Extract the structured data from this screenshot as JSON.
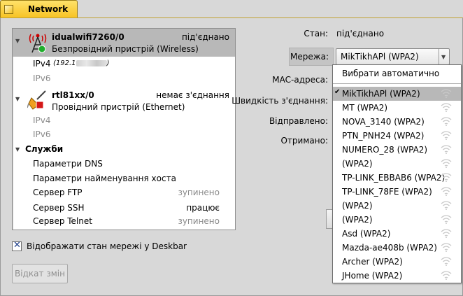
{
  "window": {
    "title": "Network"
  },
  "devices": [
    {
      "name": "idualwifi7260/0",
      "status": "під'єднано",
      "type": "Безпровідний пристрій (Wireless)",
      "ipv4_label": "IPv4",
      "ipv4_value": "(192.1",
      "ipv6_label": "IPv6",
      "icon": "wifi-antenna-icon"
    },
    {
      "name": "rtl81xx/0",
      "status": "немає з'єднання",
      "type": "Провідний пристрій (Ethernet)",
      "ipv4_label": "IPv4",
      "ipv6_label": "IPv6",
      "icon": "ethernet-plug-icon"
    }
  ],
  "services": {
    "header": "Служби",
    "items": [
      {
        "label": "Параметри DNS",
        "status": ""
      },
      {
        "label": "Параметри найменування хоста",
        "status": ""
      },
      {
        "label": "Сервер FTP",
        "status": "зупинено"
      },
      {
        "label": "Сервер SSH",
        "status": "працює"
      },
      {
        "label": "Сервер Telnet",
        "status": "зупинено"
      }
    ]
  },
  "details": {
    "state_label": "Стан:",
    "state_value": "під'єднано",
    "network_label": "Мережа:",
    "network_value": "MikTikhAPl (WPA2)",
    "mac_label": "MAC-адреса:",
    "speed_label": "Швидкість з'єднання:",
    "sent_label": "Відправлено:",
    "received_label": "Отримано:"
  },
  "network_menu": {
    "auto": "Вибрати автоматично",
    "items": [
      {
        "name": "MikTikhAPl (WPA2)",
        "selected": true
      },
      {
        "name": "MT (WPA2)"
      },
      {
        "name": "NOVA_3140 (WPA2)"
      },
      {
        "name": "PTN_PNH24 (WPA2)"
      },
      {
        "name": "NUMERO_28 (WPA2)"
      },
      {
        "name": " (WPA2)"
      },
      {
        "name": "TP-LINK_EBBAB6 (WPA2)"
      },
      {
        "name": "TP-LINK_78FE (WPA2)"
      },
      {
        "name": " (WPA2)"
      },
      {
        "name": " (WPA2)"
      },
      {
        "name": "Asd (WPA2)"
      },
      {
        "name": "Mazda-ae408b (WPA2)"
      },
      {
        "name": "Archer (WPA2)"
      },
      {
        "name": "JHome (WPA2)"
      }
    ]
  },
  "deskbar_checkbox": {
    "label": "Відображати стан мережі у Deskbar",
    "checked": true
  },
  "revert_button": {
    "label": "Відкат змін"
  },
  "colors": {
    "tab": "#f7c325",
    "selection": "#b8b8b8",
    "disabled_text": "#8a8a8a"
  }
}
